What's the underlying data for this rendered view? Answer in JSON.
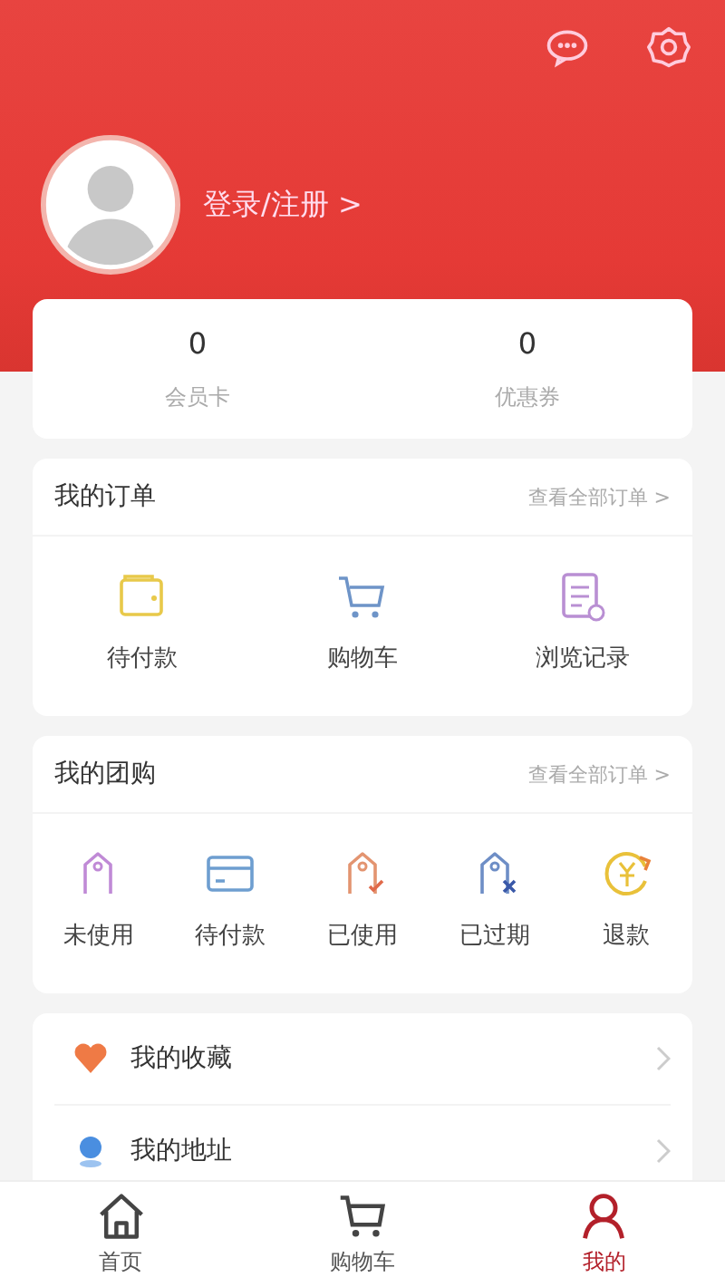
{
  "header": {
    "login_text": "登录/注册 >"
  },
  "stats": [
    {
      "value": "0",
      "label": "会员卡"
    },
    {
      "value": "0",
      "label": "优惠券"
    }
  ],
  "orders": {
    "title": "我的订单",
    "link": "查看全部订单 >",
    "items": [
      {
        "kind": "wallet",
        "label": "待付款"
      },
      {
        "kind": "cart",
        "label": "购物车"
      },
      {
        "kind": "record",
        "label": "浏览记录"
      }
    ]
  },
  "group_buy": {
    "title": "我的团购",
    "link": "查看全部订单 >",
    "items": [
      {
        "kind": "tag",
        "label": "未使用"
      },
      {
        "kind": "card",
        "label": "待付款"
      },
      {
        "kind": "tag-check",
        "label": "已使用"
      },
      {
        "kind": "tag-x",
        "label": "已过期"
      },
      {
        "kind": "refund",
        "label": "退款"
      }
    ]
  },
  "menu": [
    {
      "kind": "heart",
      "label": "我的收藏"
    },
    {
      "kind": "pin",
      "label": "我的地址"
    }
  ],
  "tab_bar": [
    {
      "kind": "home",
      "label": "首页",
      "selected": false
    },
    {
      "kind": "cart",
      "label": "购物车",
      "selected": false
    },
    {
      "kind": "person",
      "label": "我的",
      "selected": true
    }
  ]
}
